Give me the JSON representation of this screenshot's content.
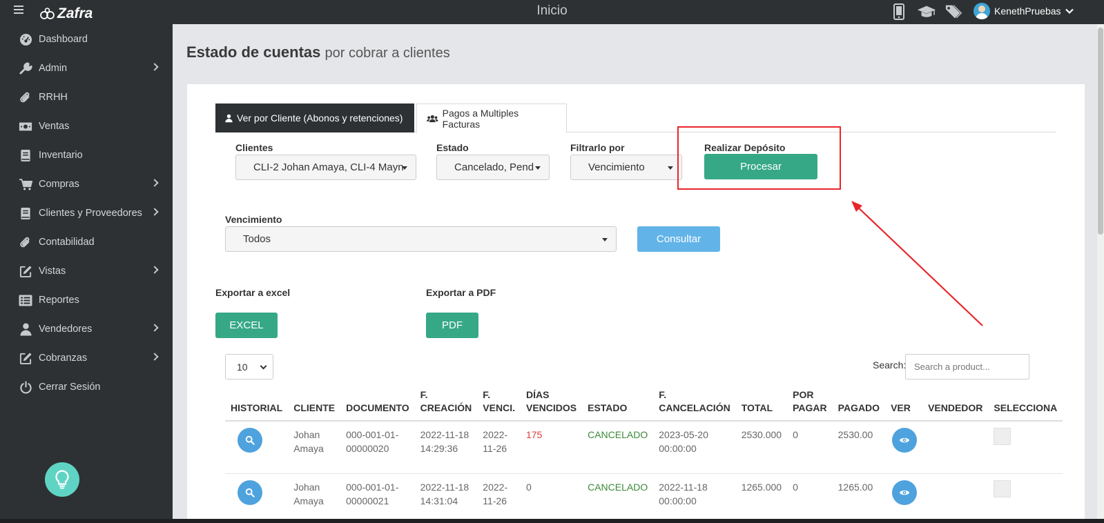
{
  "header": {
    "brand": "Zafra",
    "title": "Inicio",
    "user_name": "KenethPruebas",
    "icons": [
      "mobile-icon",
      "graduation-cap-icon",
      "tags-icon"
    ]
  },
  "sidebar": {
    "items": [
      {
        "label": "Dashboard",
        "icon": "dashboard-icon"
      },
      {
        "label": "Admin",
        "icon": "wrench-icon",
        "submenu": true
      },
      {
        "label": "RRHH",
        "icon": "paperclip-icon"
      },
      {
        "label": "Ventas",
        "icon": "money-icon"
      },
      {
        "label": "Inventario",
        "icon": "book-icon"
      },
      {
        "label": "Compras",
        "icon": "cart-icon",
        "submenu": true
      },
      {
        "label": "Clientes y Proveedores",
        "icon": "book-icon",
        "submenu": true
      },
      {
        "label": "Contabilidad",
        "icon": "paperclip-icon"
      },
      {
        "label": "Vistas",
        "icon": "edit-icon",
        "submenu": true
      },
      {
        "label": "Reportes",
        "icon": "list-icon"
      },
      {
        "label": "Vendedores",
        "icon": "user-icon",
        "submenu": true
      },
      {
        "label": "Cobranzas",
        "icon": "edit-icon",
        "submenu": true
      },
      {
        "label": "Cerrar Sesión",
        "icon": "power-icon"
      }
    ]
  },
  "page": {
    "title_bold": "Estado de cuentas",
    "title_rest": "por cobrar a clientes"
  },
  "tabs": {
    "active": "Ver por Cliente (Abonos y retenciones)",
    "second": "Pagos a Multiples Facturas"
  },
  "filters": {
    "clientes_label": "Clientes",
    "clientes_value": "CLI-2 Johan Amaya, CLI-4 Mayn",
    "estado_label": "Estado",
    "estado_value": "Cancelado, Pend",
    "filtrar_label": "Filtrarlo por",
    "filtrar_value": "Vencimiento",
    "deposito_label": "Realizar Depósito",
    "procesar_button": "Procesar",
    "vencimiento_label": "Vencimiento",
    "vencimiento_value": "Todos",
    "consultar_button": "Consultar"
  },
  "export": {
    "excel_label": "Exportar a excel",
    "excel_button": "EXCEL",
    "pdf_label": "Exportar a PDF",
    "pdf_button": "PDF"
  },
  "table_controls": {
    "page_size": "10",
    "search_label": "Search:",
    "search_placeholder": "Search a product..."
  },
  "table": {
    "headers": {
      "historial": "HISTORIAL",
      "cliente": "CLIENTE",
      "documento": "DOCUMENTO",
      "f_creacion_1": "F.",
      "f_creacion_2": "CREACIÓN",
      "f_venci_1": "F.",
      "f_venci_2": "VENCI.",
      "dias_1": "DÍAS",
      "dias_2": "VENCIDOS",
      "estado": "ESTADO",
      "f_cancel_1": "F.",
      "f_cancel_2": "CANCELACIÓN",
      "total": "TOTAL",
      "por_pagar_1": "POR",
      "por_pagar_2": "PAGAR",
      "pagado": "PAGADO",
      "ver": "VER",
      "vendedor": "VENDEDOR",
      "selecciona": "SELECCIONA"
    },
    "rows": [
      {
        "cliente": "Johan Amaya",
        "documento": "000-001-01-00000020",
        "f_creacion": "2022-11-18 14:29:36",
        "f_venci": "2022-11-26",
        "dias_vencidos": "175",
        "estado": "CANCELADO",
        "f_cancelacion": "2023-05-20 00:00:00",
        "total": "2530.000",
        "por_pagar": "0",
        "pagado": "2530.00",
        "vendedor": ""
      },
      {
        "cliente": "Johan Amaya",
        "documento": "000-001-01-00000021",
        "f_creacion": "2022-11-18 14:31:04",
        "f_venci": "2022-11-26",
        "dias_vencidos": "0",
        "estado": "CANCELADO",
        "f_cancelacion": "2022-11-18 00:00:00",
        "total": "1265.000",
        "por_pagar": "0",
        "pagado": "1265.00",
        "vendedor": ""
      }
    ]
  },
  "colors": {
    "dark": "#2e3133",
    "green": "#36a886",
    "blue": "#62b4e8",
    "red_annotation": "#e8262a",
    "state_green": "#3a8a3a",
    "days_red": "#dd3a3a"
  }
}
